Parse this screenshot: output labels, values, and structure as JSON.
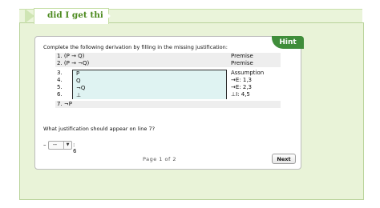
{
  "tab": {
    "title": "did I get this"
  },
  "hint_label": "Hint",
  "prompt": "Complete the following derivation by filling in the missing justification:",
  "derivation": {
    "lines": [
      {
        "stmt": "1. (P → Q)",
        "just": "Premise"
      },
      {
        "stmt": "2. (P → ¬Q)",
        "just": "Premise"
      },
      {
        "stmt": "3.",
        "just": "Assumption"
      },
      {
        "stmt": "4.",
        "just": "→E: 1,3"
      },
      {
        "stmt": "5.",
        "just": "→E: 2,3"
      },
      {
        "stmt": "6.",
        "just": "⊥I: 4,5"
      },
      {
        "stmt": "7. ¬P",
        "just": ""
      }
    ],
    "sub_lines": [
      "P",
      "Q",
      "¬Q",
      "⊥"
    ]
  },
  "question": "What justification should appear on line 7?",
  "answer": {
    "prefix": "–",
    "selected": "--",
    "line_ref": ": 6"
  },
  "pager": "Page 1 of 2",
  "next_label": "Next",
  "colors": {
    "accent": "#3f8d3a",
    "bg": "#e9f3d8",
    "title": "#4c8a1f"
  }
}
